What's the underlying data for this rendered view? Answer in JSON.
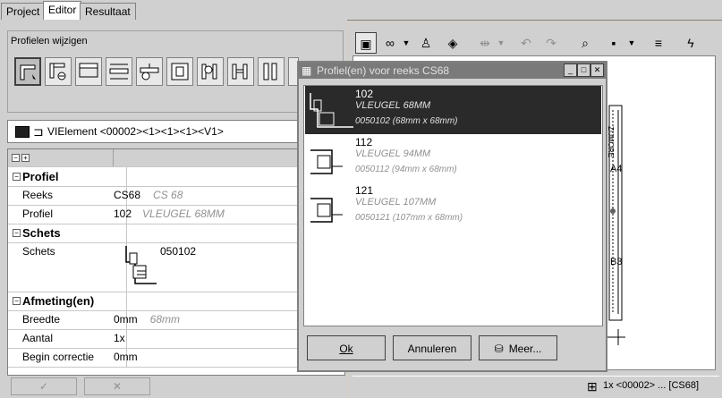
{
  "tabs": [
    {
      "label": "Project"
    },
    {
      "label": "Editor",
      "active": true
    },
    {
      "label": "Resultaat"
    }
  ],
  "left": {
    "group_title": "Profielen wijzigen",
    "element_header": "VIElement <00002><1><1><1><V1>",
    "grid": {
      "categories": {
        "profiel": "Profiel",
        "schets": "Schets",
        "afmeting": "Afmeting(en)"
      },
      "rows": {
        "reeks": {
          "label": "Reeks",
          "value": "CS68",
          "hint": "CS 68"
        },
        "profiel": {
          "label": "Profiel",
          "value": "102",
          "hint": "VLEUGEL 68MM"
        },
        "schets": {
          "label": "Schets",
          "value": "050102"
        },
        "breedte": {
          "label": "Breedte",
          "value": "0mm",
          "hint": "68mm"
        },
        "aantal": {
          "label": "Aantal",
          "value": "1x"
        },
        "begin": {
          "label": "Begin correctie",
          "value": "0mm"
        }
      }
    }
  },
  "dialog": {
    "title": "Profiel(en) voor reeks CS68",
    "items": [
      {
        "code": "102",
        "name": "VLEUGEL 68MM",
        "desc": "0050102 (68mm x 68mm)"
      },
      {
        "code": "112",
        "name": "VLEUGEL 94MM",
        "desc": "0050112 (94mm x 68mm)"
      },
      {
        "code": "121",
        "name": "VLEUGEL 107MM",
        "desc": "0050121 (107mm x 68mm)"
      }
    ],
    "buttons": {
      "ok": "Ok",
      "cancel": "Annuleren",
      "more": "Meer..."
    }
  },
  "canvas": {
    "labels": {
      "dim": "ZIJMORE",
      "a4": "A4",
      "b3": "B3"
    }
  },
  "status": {
    "text": "1x <00002> ... [CS68]"
  }
}
